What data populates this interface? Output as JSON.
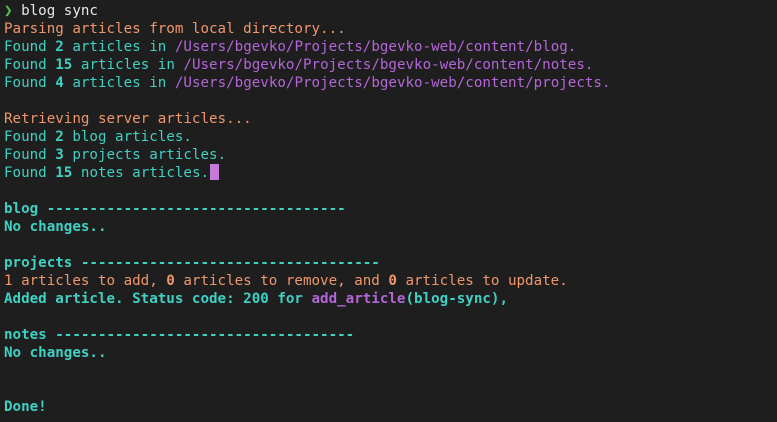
{
  "prompt": {
    "symbol": "❯",
    "command": "blog sync"
  },
  "parse": {
    "heading": "Parsing articles from local directory...",
    "found_word": "Found",
    "entries": [
      {
        "count": "2",
        "mid": " articles in ",
        "path": "/Users/bgevko/Projects/bgevko-web/content/",
        "folder": "blog",
        "end": "."
      },
      {
        "count": "15",
        "mid": " articles in ",
        "path": "/Users/bgevko/Projects/bgevko-web/content/",
        "folder": "notes",
        "end": "."
      },
      {
        "count": "4",
        "mid": " articles in ",
        "path": "/Users/bgevko/Projects/bgevko-web/content/",
        "folder": "projects",
        "end": "."
      }
    ]
  },
  "server": {
    "heading": "Retrieving server articles...",
    "found_word": "Found",
    "entries": [
      {
        "count": "2",
        "rest": " blog articles."
      },
      {
        "count": "3",
        "rest": " projects articles."
      },
      {
        "count": "15",
        "rest": " notes articles."
      }
    ]
  },
  "sections": {
    "blog": {
      "header": "blog -----------------------------------",
      "status": "No changes.."
    },
    "projects": {
      "header": "projects -----------------------------------",
      "summary_1": "1",
      "summary_2": " articles to add, ",
      "summary_3": "0",
      "summary_4": " articles to remove, and ",
      "summary_5": "0",
      "summary_6": " articles to update.",
      "added_prefix": "Added article. Status code: ",
      "status_code": "200",
      "for_word": " for ",
      "func_name": "add_article",
      "func_arg": "(blog-sync),"
    },
    "notes": {
      "header": "notes -----------------------------------",
      "status": "No changes.."
    }
  },
  "done": "Done!",
  "colors": {
    "background": "#1e1e1e",
    "orange": "#f0966b",
    "teal": "#3fd1c3",
    "purple": "#b366d6",
    "prompt_green": "#4ec94e",
    "cursor": "#c77bd9"
  }
}
